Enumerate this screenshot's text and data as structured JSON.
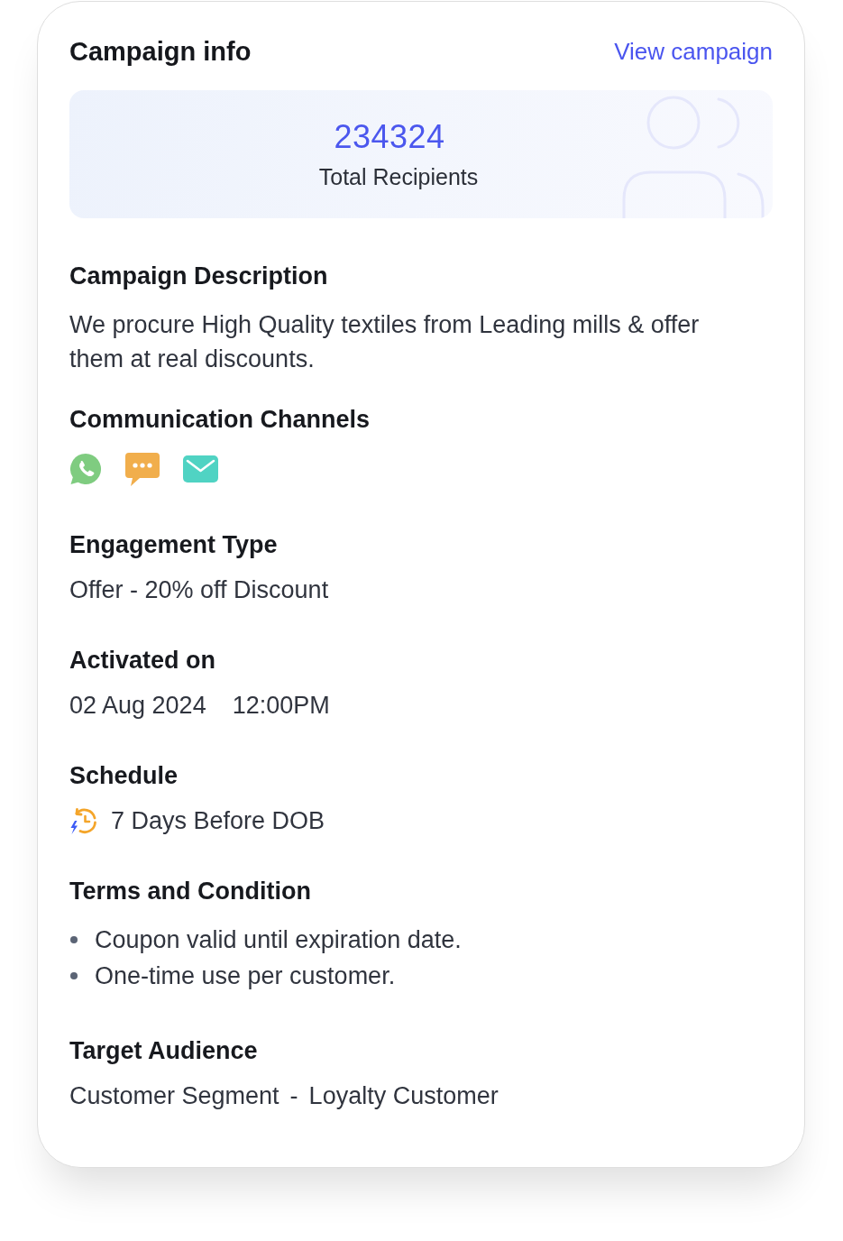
{
  "header": {
    "title": "Campaign info",
    "link": "View campaign"
  },
  "recipients": {
    "count": "234324",
    "label": "Total Recipients"
  },
  "description": {
    "heading": "Campaign Description",
    "text": "We procure High Quality textiles from Leading mills & offer them at real discounts."
  },
  "channels": {
    "heading": "Communication Channels",
    "items": [
      {
        "kind": "phone"
      },
      {
        "kind": "chat"
      },
      {
        "kind": "mail"
      }
    ]
  },
  "engagement": {
    "heading": "Engagement Type",
    "value": "Offer - 20% off Discount"
  },
  "activated": {
    "heading": "Activated on",
    "date": "02 Aug 2024",
    "time": "12:00PM"
  },
  "schedule": {
    "heading": "Schedule",
    "value": "7 Days Before DOB"
  },
  "terms": {
    "heading": "Terms and Condition",
    "items": [
      "Coupon valid until expiration date.",
      "One-time use per customer."
    ]
  },
  "audience": {
    "heading": "Target Audience",
    "segment": "Customer Segment",
    "separator": "-",
    "value": "Loyalty Customer"
  }
}
